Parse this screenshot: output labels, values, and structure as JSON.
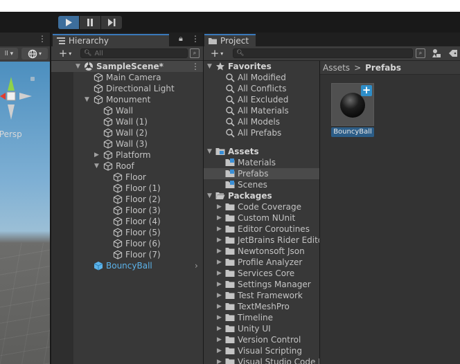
{
  "toolbar": {
    "play_icon": "play-icon",
    "pause_icon": "pause-icon",
    "step_icon": "step-icon"
  },
  "scene": {
    "persp_label": "‹Persp",
    "gizmo_icon": "scene-gizmo-icon"
  },
  "hierarchy": {
    "tab_label": "Hierarchy",
    "search_placeholder": "All",
    "scene_name": "SampleScene*",
    "items": [
      {
        "label": "Main Camera"
      },
      {
        "label": "Directional Light"
      },
      {
        "label": "Monument"
      },
      {
        "label": "Wall"
      },
      {
        "label": "Wall (1)"
      },
      {
        "label": "Wall (2)"
      },
      {
        "label": "Wall (3)"
      },
      {
        "label": "Platform"
      },
      {
        "label": "Roof"
      },
      {
        "label": "Floor"
      },
      {
        "label": "Floor (1)"
      },
      {
        "label": "Floor (2)"
      },
      {
        "label": "Floor (3)"
      },
      {
        "label": "Floor (4)"
      },
      {
        "label": "Floor (5)"
      },
      {
        "label": "Floor (6)"
      },
      {
        "label": "Floor (7)"
      },
      {
        "label": "BouncyBall"
      }
    ]
  },
  "project": {
    "tab_label": "Project",
    "favorites_label": "Favorites",
    "favorites": [
      {
        "label": "All Modified"
      },
      {
        "label": "All Conflicts"
      },
      {
        "label": "All Excluded"
      },
      {
        "label": "All Materials"
      },
      {
        "label": "All Models"
      },
      {
        "label": "All Prefabs"
      }
    ],
    "assets_label": "Assets",
    "assets": [
      {
        "label": "Materials"
      },
      {
        "label": "Prefabs"
      },
      {
        "label": "Scenes"
      }
    ],
    "packages_label": "Packages",
    "packages": [
      {
        "label": "Code Coverage"
      },
      {
        "label": "Custom NUnit"
      },
      {
        "label": "Editor Coroutines"
      },
      {
        "label": "JetBrains Rider Editor"
      },
      {
        "label": "Newtonsoft Json"
      },
      {
        "label": "Profile Analyzer"
      },
      {
        "label": "Services Core"
      },
      {
        "label": "Settings Manager"
      },
      {
        "label": "Test Framework"
      },
      {
        "label": "TextMeshPro"
      },
      {
        "label": "Timeline"
      },
      {
        "label": "Unity UI"
      },
      {
        "label": "Version Control"
      },
      {
        "label": "Visual Scripting"
      },
      {
        "label": "Visual Studio Code Editor"
      }
    ],
    "breadcrumb": {
      "root": "Assets",
      "separator": ">",
      "current": "Prefabs"
    },
    "asset_tile": {
      "label": "BouncyBall"
    }
  },
  "colors": {
    "accent": "#3a79bb",
    "play_active": "#3d6e9c",
    "prefab_blue": "#5cb3ea",
    "panel": "#383838"
  }
}
